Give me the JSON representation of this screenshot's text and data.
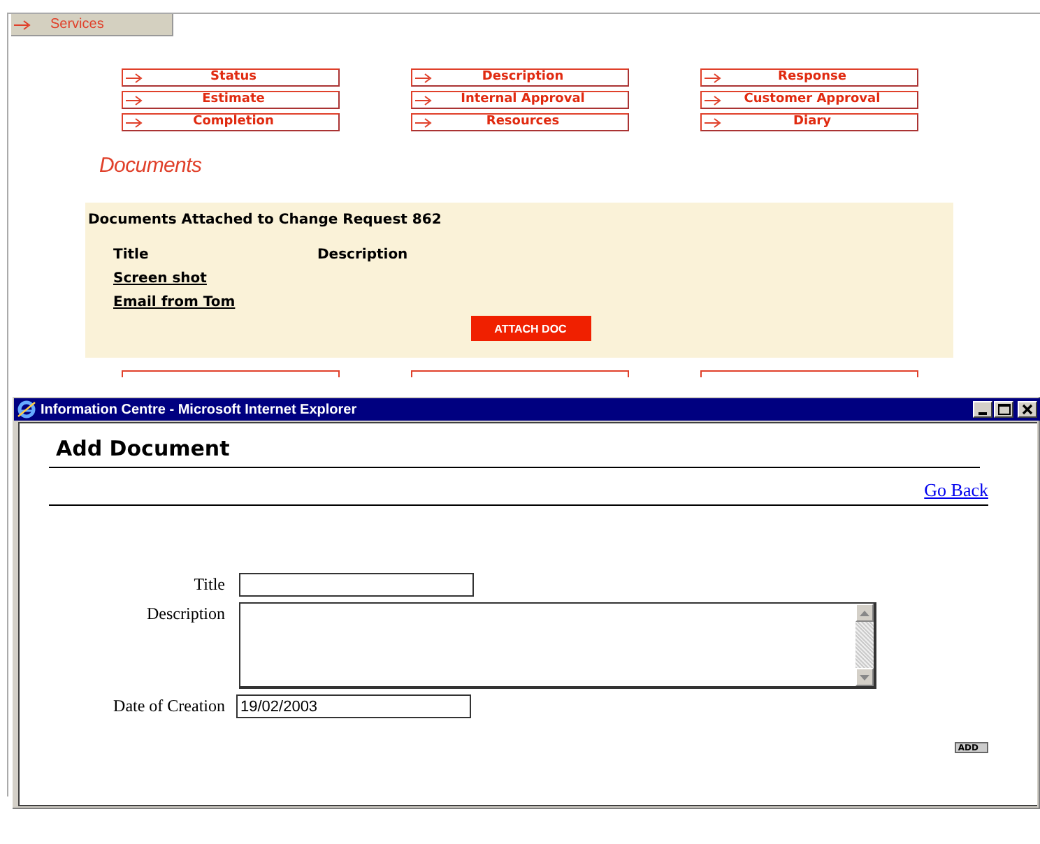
{
  "services_tab": {
    "label": "Services"
  },
  "nav": [
    [
      {
        "label": "Status"
      },
      {
        "label": "Description"
      },
      {
        "label": "Response"
      }
    ],
    [
      {
        "label": "Estimate"
      },
      {
        "label": "Internal Approval"
      },
      {
        "label": "Customer Approval"
      }
    ],
    [
      {
        "label": "Completion"
      },
      {
        "label": "Resources"
      },
      {
        "label": "Diary"
      }
    ]
  ],
  "section_heading": "Documents",
  "documents_panel": {
    "heading": "Documents Attached to Change Request 862",
    "columns": [
      "Title",
      "Description"
    ],
    "rows": [
      {
        "title": "Screen shot"
      },
      {
        "title": "Email from Tom"
      }
    ],
    "attach_button": "ATTACH DOC"
  },
  "popup": {
    "title": "Information Centre - Microsoft Internet Explorer",
    "heading": "Add Document",
    "go_back": "Go Back",
    "fields": [
      {
        "kind": "text",
        "label": "Title"
      },
      {
        "kind": "textarea",
        "label": "Description"
      },
      {
        "kind": "date",
        "label": "Date of Creation",
        "value": "19/02/2003"
      }
    ],
    "add_button": "ADD"
  }
}
